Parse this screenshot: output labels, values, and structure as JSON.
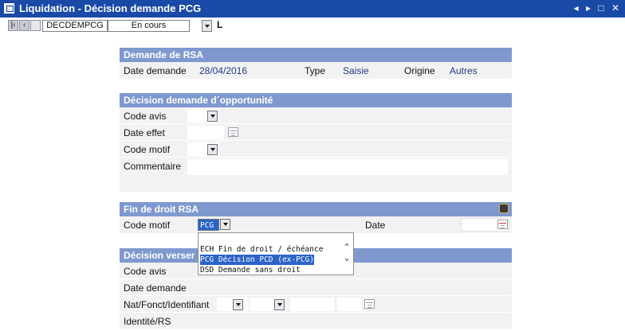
{
  "window": {
    "title": "Liquidation - Décision demande PCG",
    "controls": "◂ ▸ □ ✕"
  },
  "toolbar": {
    "record_code": "DECDEMPCG",
    "status": "En cours",
    "mode_letter": "L"
  },
  "demande_rsa": {
    "header": "Demande de RSA",
    "date_label": "Date demande",
    "date_value": "28/04/2016",
    "type_label": "Type",
    "type_value": "Saisie",
    "origine_label": "Origine",
    "origine_value": "Autres"
  },
  "decision_opportunite": {
    "header": "Décision demande d´opportunité",
    "code_avis_label": "Code avis",
    "date_effet_label": "Date effet",
    "code_motif_label": "Code motif",
    "commentaire_label": "Commentaire"
  },
  "fin_droit": {
    "header": "Fin de droit RSA",
    "code_motif_label": "Code motif",
    "code_motif_value": "PCG",
    "date_label": "Date"
  },
  "dropdown": {
    "options": [
      "ECH Fin de droit / échéance",
      "PCG Décision PCD (ex-PCG)",
      "DSD Demande sans droit"
    ],
    "selected_index": 1
  },
  "decision_versement": {
    "header": "Décision verser",
    "code_avis_label": "Code avis",
    "date_demande_label": "Date demande",
    "nat_label": "Nat/Fonct/Identifiant",
    "identite_label": "Identité/RS"
  }
}
